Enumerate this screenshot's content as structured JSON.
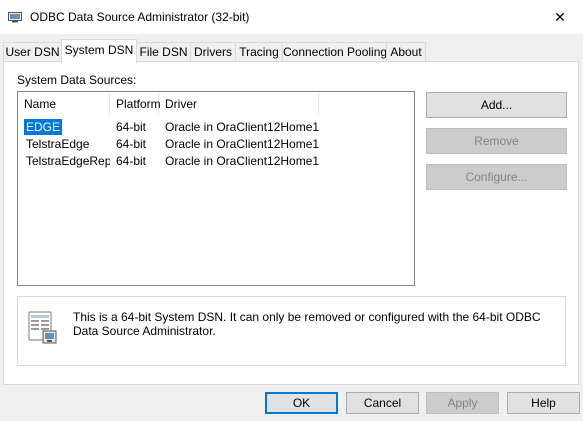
{
  "window": {
    "title": "ODBC Data Source Administrator (32-bit)",
    "close_glyph": "✕"
  },
  "tabs": [
    {
      "label": "User DSN",
      "active": false
    },
    {
      "label": "System DSN",
      "active": true
    },
    {
      "label": "File DSN",
      "active": false
    },
    {
      "label": "Drivers",
      "active": false
    },
    {
      "label": "Tracing",
      "active": false
    },
    {
      "label": "Connection Pooling",
      "active": false
    },
    {
      "label": "About",
      "active": false
    }
  ],
  "system_dsn": {
    "group_label": "System Data Sources:",
    "columns": [
      "Name",
      "Platform",
      "Driver"
    ],
    "rows": [
      {
        "name": "EDGE",
        "platform": "64-bit",
        "driver": "Oracle in OraClient12Home1",
        "selected": true
      },
      {
        "name": "TelstraEdge",
        "platform": "64-bit",
        "driver": "Oracle in OraClient12Home1",
        "selected": false
      },
      {
        "name": "TelstraEdgeRepo",
        "platform": "64-bit",
        "driver": "Oracle in OraClient12Home1",
        "selected": false
      }
    ],
    "add_label": "Add...",
    "remove_label": "Remove",
    "configure_label": "Configure...",
    "info_text": "This is a 64-bit System DSN. It can only be removed or configured with the 64-bit ODBC Data Source Administrator."
  },
  "footer": {
    "ok_label": "OK",
    "cancel_label": "Cancel",
    "apply_label": "Apply",
    "help_label": "Help"
  },
  "colors": {
    "selection": "#0078d7",
    "default_button_border": "#0078d7"
  }
}
